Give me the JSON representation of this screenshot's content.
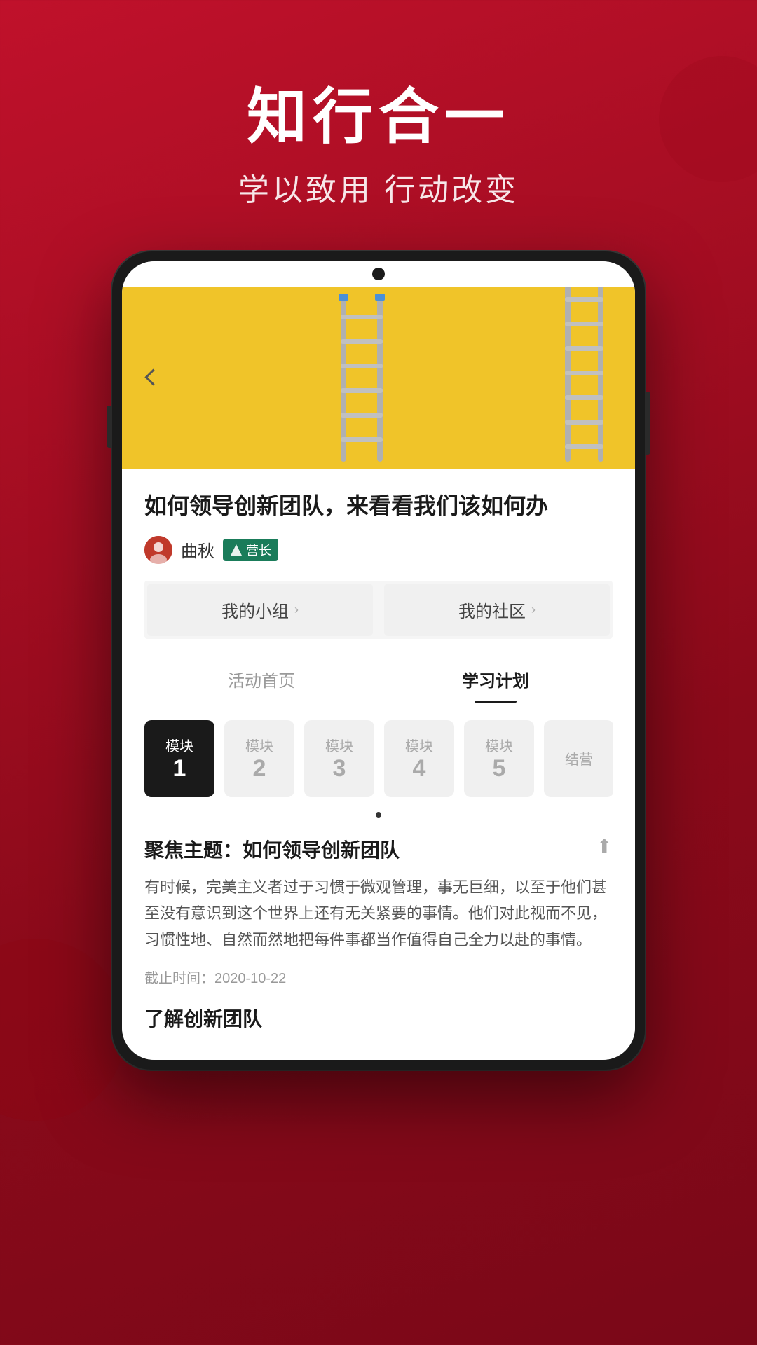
{
  "hero": {
    "title": "知行合一",
    "subtitle": "学以致用 行动改变"
  },
  "phone": {
    "backBtn": "‹"
  },
  "article": {
    "title": "如何领导创新团队，来看看我们该如何办",
    "author": {
      "name": "曲秋",
      "badge": "营长"
    },
    "actionBtns": [
      {
        "label": "我的小组",
        "icon": "›"
      },
      {
        "label": "我的社区",
        "icon": "›"
      }
    ],
    "tabs": [
      {
        "label": "活动首页",
        "active": false
      },
      {
        "label": "学习计划",
        "active": true
      }
    ],
    "modules": [
      {
        "label": "模块",
        "num": "1",
        "active": true
      },
      {
        "label": "模块",
        "num": "2",
        "active": false
      },
      {
        "label": "模块",
        "num": "3",
        "active": false
      },
      {
        "label": "模块",
        "num": "4",
        "active": false
      },
      {
        "label": "模块",
        "num": "5",
        "active": false
      },
      {
        "label": "结营",
        "num": "",
        "active": false
      }
    ],
    "sectionTitle": "聚焦主题：如何领导创新团队",
    "sectionBody": "有时候，完美主义者过于习惯于微观管理，事无巨细，以至于他们甚至没有意识到这个世界上还有无关紧要的事情。他们对此视而不见，习惯性地、自然而然地把每件事都当作值得自己全力以赴的事情。",
    "deadline": "截止时间：2020-10-22",
    "sectionTitle2": "了解创新团队"
  }
}
